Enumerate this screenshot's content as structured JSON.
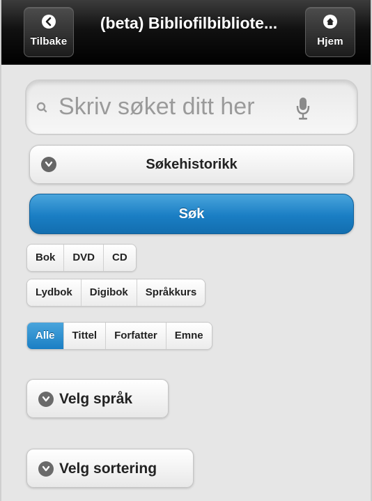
{
  "header": {
    "title": "(beta) Bibliofilbibliote...",
    "back_label": "Tilbake",
    "back_icon": "chevron-left-icon",
    "home_label": "Hjem",
    "home_icon": "home-icon"
  },
  "search": {
    "placeholder": "Skriv søket ditt her",
    "value": "",
    "search_icon": "search-icon",
    "mic_icon": "microphone-icon"
  },
  "history": {
    "label": "Søkehistorikk",
    "icon": "chevron-down-icon"
  },
  "search_button": {
    "label": "Søk",
    "color": "#1a7ec4"
  },
  "format_filter_1": {
    "options": [
      "Bok",
      "DVD",
      "CD"
    ]
  },
  "format_filter_2": {
    "options": [
      "Lydbok",
      "Digibok",
      "Språkkurs"
    ]
  },
  "field_filter": {
    "options": [
      "Alle",
      "Tittel",
      "Forfatter",
      "Emne"
    ],
    "selected": "Alle"
  },
  "language_select": {
    "label": "Velg språk",
    "icon": "chevron-down-icon"
  },
  "sort_select": {
    "label": "Velg sortering",
    "icon": "chevron-down-icon"
  }
}
